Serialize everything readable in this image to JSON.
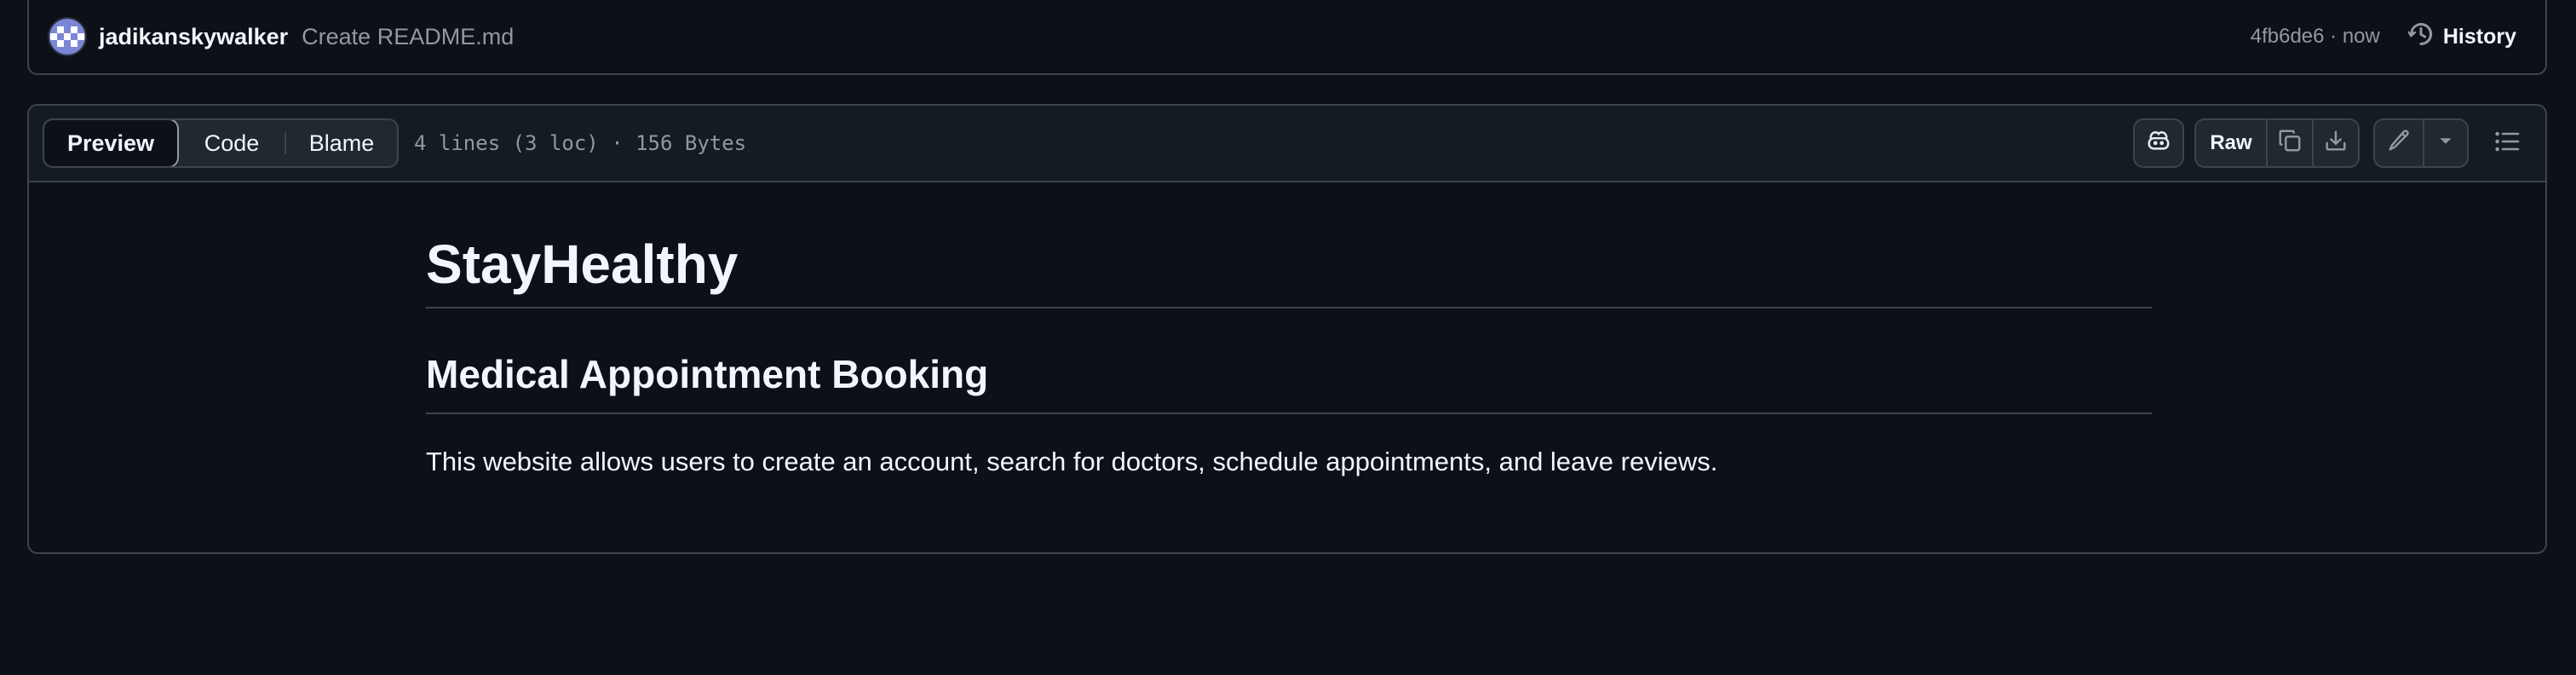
{
  "commit": {
    "author": "jadikanskywalker",
    "message": "Create README.md",
    "sha_time": "4fb6de6 · now",
    "history_label": "History"
  },
  "file_header": {
    "tabs": [
      {
        "label": "Preview",
        "active": true
      },
      {
        "label": "Code",
        "active": false
      },
      {
        "label": "Blame",
        "active": false
      }
    ],
    "file_info": "4 lines (3 loc) · 156 Bytes",
    "raw_label": "Raw",
    "icons": {
      "copilot": "copilot-icon",
      "copy": "copy-icon",
      "download": "download-icon",
      "edit": "pencil-icon",
      "edit_menu": "triangle-down-icon",
      "outline": "list-unordered-icon",
      "history": "history-icon"
    }
  },
  "readme": {
    "h1": "StayHealthy",
    "h2": "Medical Appointment Booking",
    "paragraph": "This website allows users to create an account, search for doctors, schedule appointments, and leave reviews."
  },
  "colors": {
    "background": "#0d1117",
    "header_bg": "#151b23",
    "border": "#3d444d",
    "text": "#f0f6fc",
    "muted": "#9198a1"
  }
}
